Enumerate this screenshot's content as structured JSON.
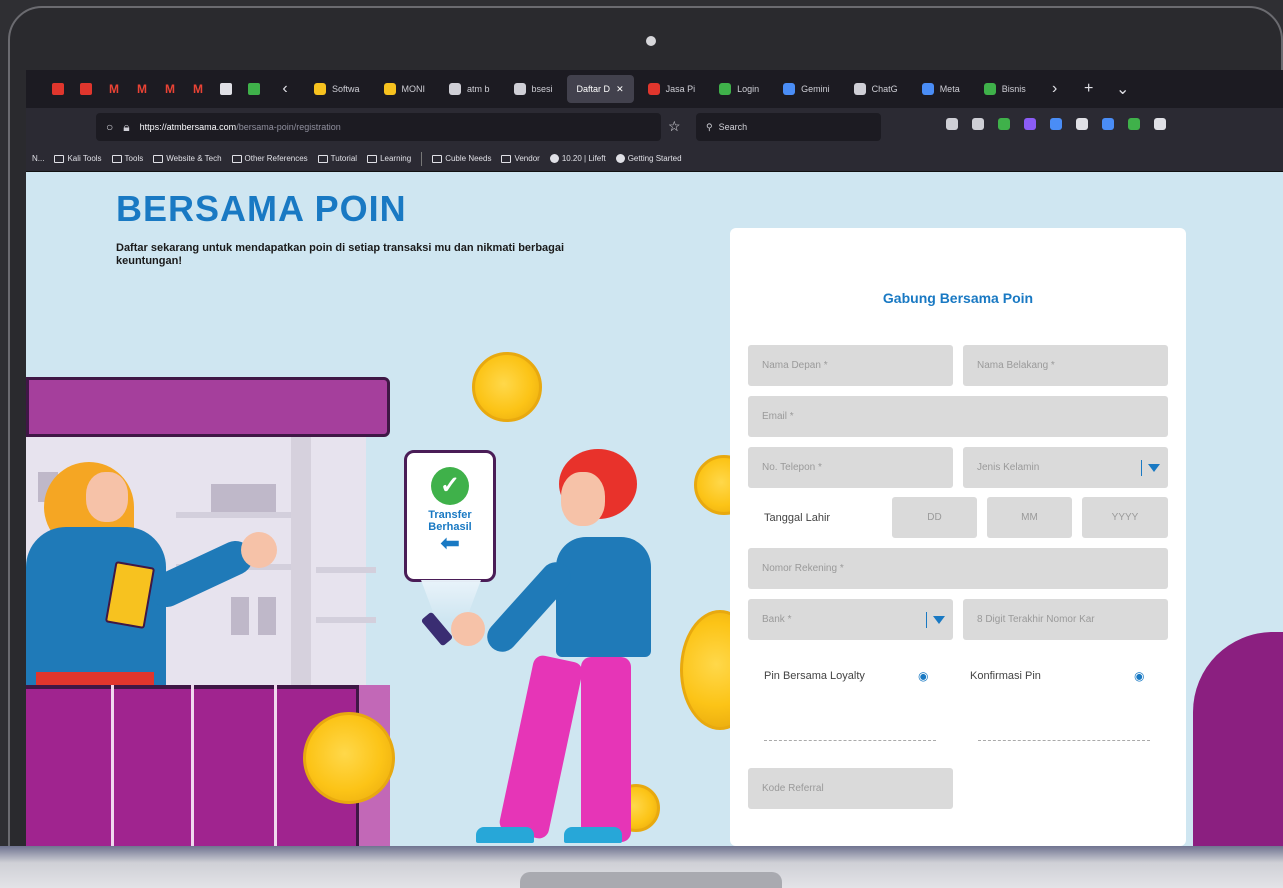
{
  "browser": {
    "pinned_favicons": [
      {
        "name": "favicon-red-1",
        "color": "#e0362d"
      },
      {
        "name": "favicon-red-2",
        "color": "#e0362d"
      },
      {
        "name": "gmail-icon-1",
        "glyph": "M",
        "color": "#ea4335"
      },
      {
        "name": "gmail-icon-2",
        "glyph": "M",
        "color": "#ea4335"
      },
      {
        "name": "gmail-icon-3",
        "glyph": "M",
        "color": "#ea4335"
      },
      {
        "name": "gmail-icon-4",
        "glyph": "M",
        "color": "#ea4335"
      },
      {
        "name": "chrome-icon",
        "color": "#e0e0e6"
      },
      {
        "name": "leaf-icon",
        "color": "#3fb14a"
      }
    ],
    "tabs": [
      {
        "label": "Softwa",
        "color": "#f7c21f",
        "active": false
      },
      {
        "label": "MONI",
        "color": "#f7c21f",
        "active": false
      },
      {
        "label": "atm b",
        "color": "#cfcfd6",
        "active": false
      },
      {
        "label": "bsesi",
        "color": "#cfcfd6",
        "active": false
      },
      {
        "label": "Daftar D",
        "color": "",
        "active": true
      },
      {
        "label": "Jasa Pi",
        "color": "#e0362d",
        "active": false
      },
      {
        "label": "Login",
        "color": "#3fb14a",
        "active": false
      },
      {
        "label": "Gemini",
        "color": "#4a8df6",
        "active": false
      },
      {
        "label": "ChatG",
        "color": "#cfcfd6",
        "active": false
      },
      {
        "label": "Meta",
        "color": "#4a8df6",
        "active": false
      },
      {
        "label": "Bisnis",
        "color": "#3fb14a",
        "active": false
      }
    ],
    "tab_close": "✕",
    "tab_more": "›",
    "new_tab": "+",
    "tab_list": "⌄",
    "url_domain": "https://atmbersama.com",
    "url_path": "/bersama-poin/registration",
    "search_placeholder": "Search",
    "extensions": [
      "#cfcfd6",
      "#cfcfd6",
      "#3fb14a",
      "#8b5cf6",
      "#4a8df6",
      "#e0e0e6",
      "#4a8df6",
      "#3fb14a",
      "#e0e0e6"
    ],
    "bookmarks": [
      "Kali Tools",
      "Tools",
      "Website & Tech",
      "Other References",
      "Tutorial",
      "Learning"
    ],
    "bookmarks_first": "N...",
    "bookmarks_after_sep": [
      "Cuble Needs",
      "Vendor"
    ],
    "bookmarks_globe": [
      "10.20 | Lifeft",
      "Getting Started"
    ]
  },
  "hero": {
    "title": "BERSAMA POIN",
    "subtitle": "Daftar sekarang untuk mendapatkan poin di setiap transaksi mu dan nikmati berbagai keuntungan!"
  },
  "sign": {
    "line1": "Transfer",
    "line2": "Berhasil",
    "arrow": "⬅",
    "check": "✓"
  },
  "form": {
    "title": "Gabung Bersama Poin",
    "first_name": "Nama Depan *",
    "last_name": "Nama Belakang *",
    "email": "Email *",
    "phone": "No. Telepon *",
    "gender": "Jenis Kelamin",
    "birthdate_label": "Tanggal Lahir",
    "day": "DD",
    "month": "MM",
    "year": "YYYY",
    "account_number": "Nomor Rekening *",
    "bank": "Bank *",
    "card_last8": "8 Digit Terakhir Nomor Kar",
    "pin_label": "Pin Bersama Loyalty",
    "pin_confirm_label": "Konfirmasi Pin",
    "referral": "Kode Referral"
  }
}
